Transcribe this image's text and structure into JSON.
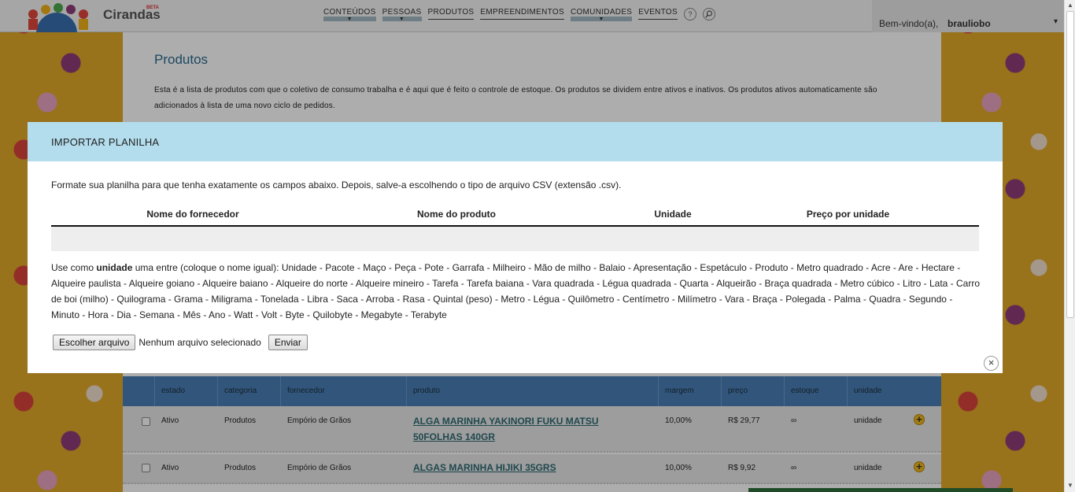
{
  "header": {
    "logo_text": "Cirandas",
    "logo_badge": "BETA",
    "nav": [
      {
        "label": "CONTEÚDOS",
        "dropdown": true
      },
      {
        "label": "PESSOAS",
        "dropdown": true
      },
      {
        "label": "PRODUTOS",
        "dropdown": false
      },
      {
        "label": "EMPREENDIMENTOS",
        "dropdown": false
      },
      {
        "label": "COMUNIDADES",
        "dropdown": true
      },
      {
        "label": "EVENTOS",
        "dropdown": false
      }
    ],
    "help_icon": "?",
    "search_icon": "search-icon",
    "welcome": "Bem-vindo(a),",
    "username": "brauliobo",
    "user_caret": "▾"
  },
  "page": {
    "title": "Produtos",
    "description": "Esta é a lista de produtos com que o coletivo de consumo trabalha e é aqui que é feito o controle de estoque. Os produtos se dividem entre ativos e inativos. Os produtos ativos automaticamente são adicionados à lista de uma novo ciclo de pedidos."
  },
  "table": {
    "columns": [
      "estado",
      "categoria",
      "fornecedor",
      "produto",
      "margem",
      "preço",
      "estoque",
      "unidade"
    ],
    "rows": [
      {
        "estado": "Ativo",
        "categoria": "Produtos",
        "fornecedor": "Empório de Grãos",
        "produto": "ALGA MARINHA YAKINORI FUKU MATSU 50FOLHAS 140GR",
        "margem": "10,00%",
        "preco": "R$ 29,77",
        "estoque": "∞",
        "unidade": "unidade"
      },
      {
        "estado": "Ativo",
        "categoria": "Produtos",
        "fornecedor": "Empório de Grãos",
        "produto": "ALGAS MARINHA HIJIKI 35GRS",
        "margem": "10,00%",
        "preco": "R$ 9,92",
        "estoque": "∞",
        "unidade": "unidade"
      }
    ]
  },
  "modal": {
    "title": "IMPORTAR PLANILHA",
    "intro": "Formate sua planilha para que tenha exatamente os campos abaixo. Depois, salve-a escolhendo o tipo de arquivo CSV (extensão .csv).",
    "columns": [
      "Nome do fornecedor",
      "Nome do produto",
      "Unidade",
      "Preço por unidade"
    ],
    "units_prefix": "Use como",
    "units_keyword": "unidade",
    "units_text": "uma entre (coloque o nome igual): Unidade - Pacote - Maço - Peça - Pote - Garrafa - Milheiro - Mão de milho - Balaio - Apresentação - Espetáculo - Produto - Metro quadrado - Acre - Are - Hectare - Alqueire paulista - Alqueire goiano - Alqueire baiano - Alqueire do norte - Alqueire mineiro - Tarefa - Tarefa baiana - Vara quadrada - Légua quadrada - Quarta - Alqueirão - Braça quadrada - Metro cúbico - Litro - Lata - Carro de boi (milho) - Quilograma - Grama - Miligrama - Tonelada - Libra - Saca - Arroba - Rasa - Quintal (peso) - Metro - Légua - Quilômetro - Centímetro - Milímetro - Vara - Braça - Polegada - Palma - Quadra - Segundo - Minuto - Hora - Dia - Semana - Mês - Ano - Watt - Volt - Byte - Quilobyte - Megabyte - Terabyte",
    "choose_file": "Escolher arquivo",
    "file_status": "Nenhum arquivo selecionado",
    "submit": "Enviar",
    "close": "×"
  },
  "colors": {
    "modal_header": "#b3dded",
    "table_header": "#4a7fb5",
    "page_title": "#2a6b8f",
    "product_link": "#2f6a73",
    "add_icon": "#f1b81c"
  }
}
